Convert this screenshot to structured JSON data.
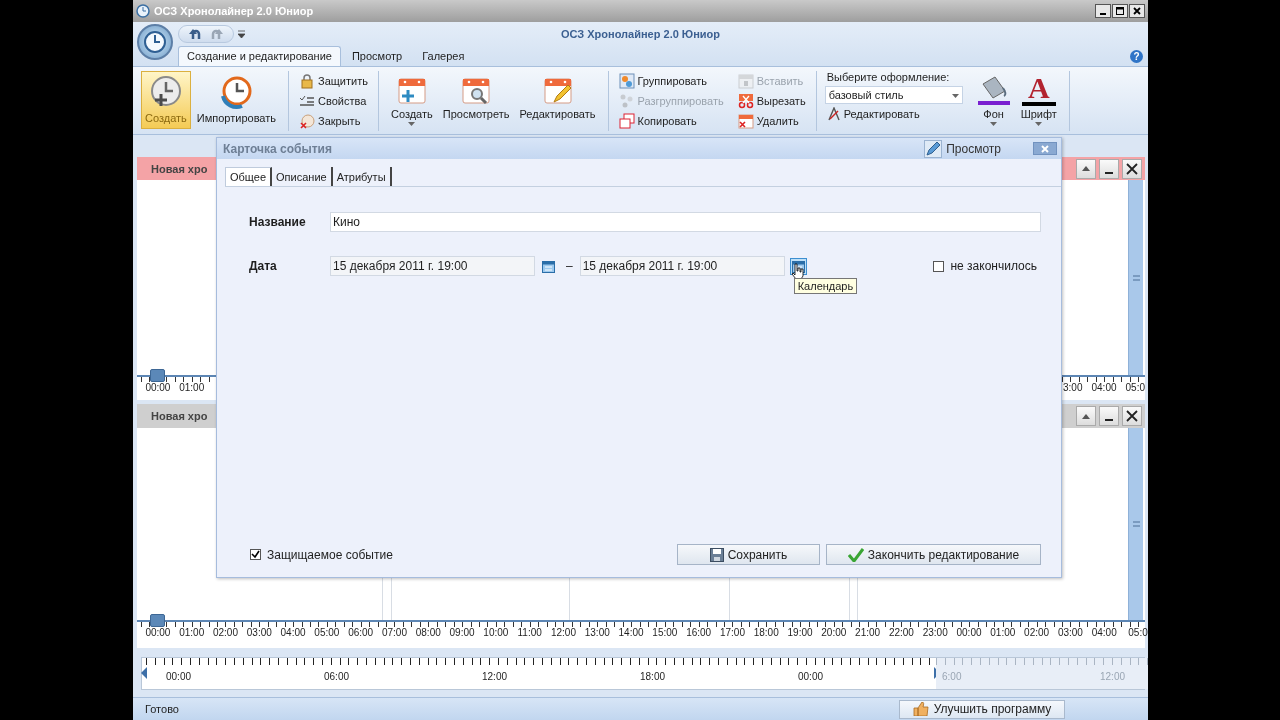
{
  "window": {
    "title": "ОСЗ Хронолайнер 2.0 Юниор"
  },
  "ribbon": {
    "app_title": "ОСЗ Хронолайнер 2.0 Юниор",
    "help": "?",
    "tabs": [
      {
        "label": "Создание и редактирование",
        "selected": true
      },
      {
        "label": "Просмотр",
        "selected": false
      },
      {
        "label": "Галерея",
        "selected": false
      }
    ],
    "groups": [
      {
        "kind": "large",
        "items": [
          {
            "label": "Создать",
            "highlighted": true,
            "dropdown": false
          },
          {
            "label": "Импортировать",
            "highlighted": false,
            "dropdown": false
          }
        ]
      },
      {
        "kind": "small",
        "items": [
          {
            "label": "Защитить",
            "disabled": false
          },
          {
            "label": "Свойства",
            "disabled": false
          },
          {
            "label": "Закрыть",
            "disabled": false
          }
        ]
      },
      {
        "kind": "large",
        "items": [
          {
            "label": "Создать",
            "highlighted": false,
            "dropdown": true
          },
          {
            "label": "Просмотреть",
            "highlighted": false,
            "dropdown": false
          },
          {
            "label": "Редактировать",
            "highlighted": false,
            "dropdown": false
          }
        ]
      },
      {
        "kind": "small",
        "items": [
          {
            "label": "Группировать",
            "disabled": false
          },
          {
            "label": "Разгруппировать",
            "disabled": true
          },
          {
            "label": "Копировать",
            "disabled": false
          },
          {
            "label": "Вставить",
            "disabled": true
          },
          {
            "label": "Вырезать",
            "disabled": false
          },
          {
            "label": "Удалить",
            "disabled": false
          }
        ]
      },
      {
        "kind": "style",
        "label": "Выберите оформление:",
        "select": "базовый стиль",
        "edit": "Редактировать",
        "items": [
          {
            "label": "Фон",
            "dropdown": true
          },
          {
            "label": "Шрифт",
            "dropdown": true,
            "glyph": "A"
          }
        ]
      }
    ]
  },
  "timelines": [
    {
      "title": "Новая хро",
      "active": true,
      "ruler_left": [
        "00:00",
        "01:00"
      ],
      "ruler_right": [
        "3:00",
        "04:00",
        "05:0"
      ]
    },
    {
      "title": "Новая хро",
      "active": false,
      "ruler": [
        "00:00",
        "01:00",
        "02:00",
        "03:00",
        "04:00",
        "05:00",
        "06:00",
        "07:00",
        "08:00",
        "09:00",
        "10:00",
        "11:00",
        "12:00",
        "13:00",
        "14:00",
        "15:00",
        "16:00",
        "17:00",
        "18:00",
        "19:00",
        "20:00",
        "21:00",
        "22:00",
        "23:00",
        "00:00",
        "01:00",
        "02:00",
        "03:00",
        "04:00",
        "05:0"
      ]
    }
  ],
  "overview": {
    "labels": [
      "00:00",
      "06:00",
      "12:00",
      "18:00",
      "00:00"
    ],
    "outside_labels": [
      "6:00",
      "12:00"
    ]
  },
  "dialog": {
    "title": "Карточка события",
    "mode_button": "Просмотр",
    "tabs": [
      {
        "label": "Общее",
        "selected": true
      },
      {
        "label": "Описание",
        "selected": false
      },
      {
        "label": "Атрибуты",
        "selected": false
      }
    ],
    "name": {
      "label": "Название",
      "value": "Кино"
    },
    "date": {
      "label": "Дата",
      "start": {
        "value": "15 декабря 2011 г. 19:00",
        "calendar_hovered": false
      },
      "separator": "–",
      "end": {
        "value": "15 декабря 2011 г. 19:00",
        "calendar_hovered": true
      },
      "tooltip": "Календарь"
    },
    "open_ended": {
      "label": "не закончилось",
      "checked": false
    },
    "protected": {
      "label": "Защищаемое событие",
      "checked": true
    },
    "buttons": [
      {
        "label": "Сохранить",
        "kind": "save"
      },
      {
        "label": "Закончить редактирование",
        "kind": "finish"
      }
    ]
  },
  "status_bar": {
    "text": "Готово",
    "upgrade_button": "Улучшить программу"
  }
}
